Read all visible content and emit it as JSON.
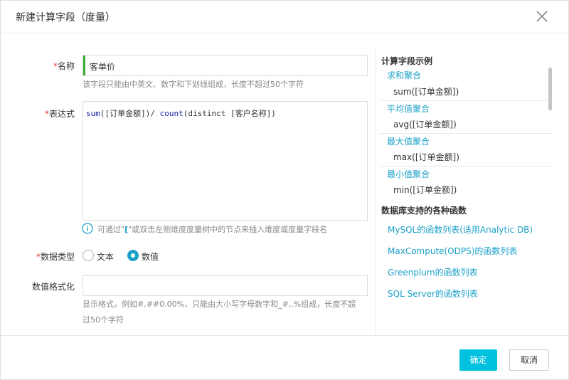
{
  "dialog": {
    "title": "新建计算字段（度量）",
    "close_icon": "close-icon"
  },
  "form": {
    "name_label": "名称",
    "name_value": "客单价",
    "name_hint": "该字段只能由中英文、数字和下划线组成，长度不超过50个字符",
    "expr_label": "表达式",
    "expr_parts": {
      "kw_sum": "sum",
      "part1": "([订单金额])/ ",
      "kw_count": "count",
      "part2": "(distinct [客户名称])"
    },
    "info_prefix": "可通过\"",
    "info_bracket": "[",
    "info_suffix": "\"或双击左侧维度度量树中的节点来插入维度或度量字段名",
    "type_label": "数据类型",
    "type_options": [
      "文本",
      "数值"
    ],
    "type_selected": "数值",
    "format_label": "数值格式化",
    "format_value": "",
    "format_hint_line1": "显示格式，例如#,##0.00%，只能由大小写字母数字和_#,.%组成，长度不超",
    "format_hint_line2": "过50个字符"
  },
  "sidebar": {
    "examples_title": "计算字段示例",
    "examples": [
      {
        "name": "求和聚合",
        "code": "sum([订单金额])"
      },
      {
        "name": "平均值聚合",
        "code": "avg([订单金额])"
      },
      {
        "name": "最大值聚合",
        "code": "max([订单金额])"
      },
      {
        "name": "最小值聚合",
        "code": "min([订单金额])"
      }
    ],
    "functions_title": "数据库支持的各种函数",
    "functions": [
      "MySQL的函数列表(适用Analytic DB)",
      "MaxCompute(ODPS)的函数列表",
      "Greenplum的函数列表",
      "SQL Server的函数列表"
    ]
  },
  "footer": {
    "ok_label": "确定",
    "cancel_label": "取消"
  },
  "colors": {
    "accent": "#00c1de",
    "link": "#1ba1c8",
    "required": "#e3393c",
    "name_bar": "#3aa93a"
  }
}
